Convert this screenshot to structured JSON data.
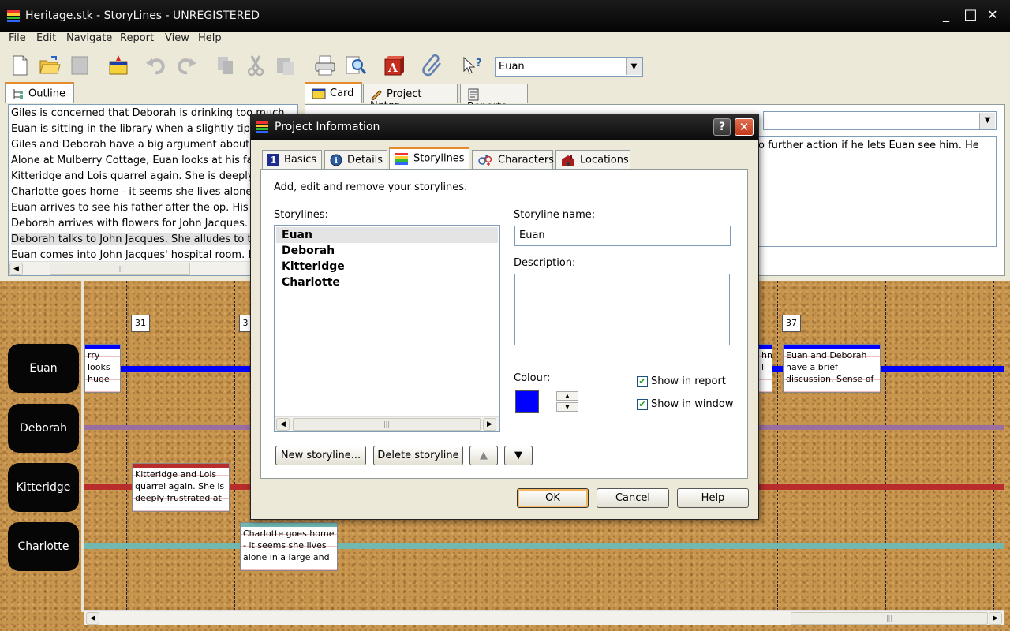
{
  "window": {
    "title": "Heritage.stk - StoryLines - UNREGISTERED",
    "controls": {
      "minimize": "_",
      "maximize": "□",
      "close": "✕"
    }
  },
  "menu": [
    "File",
    "Edit",
    "Navigate",
    "Report",
    "View",
    "Help"
  ],
  "toolbar": {
    "character_select": "Euan",
    "icons": [
      "new-document-icon",
      "open-folder-icon",
      "save-icon",
      "card-icon",
      "undo-icon",
      "redo-icon",
      "copy-icon",
      "cut-icon",
      "paste-icon",
      "print-icon",
      "print-preview-icon",
      "font-icon",
      "attach-icon",
      "help-pointer-icon"
    ]
  },
  "left_panel": {
    "tab": "Outline",
    "outline_rows": [
      "Giles is concerned that Deborah is drinking too much.",
      "Euan is sitting in the library when a slightly tipsy Deborah",
      "Giles and Deborah have a big argument about ferti",
      "Alone at Mulberry Cottage, Euan looks at his father",
      "Kitteridge and Lois quarrel again. She is deeply fru",
      "Charlotte goes home - it seems she lives alone in a",
      "Euan arrives to see his father after the op. His fath",
      "Deborah arrives with flowers for John Jacques. Eu",
      "Deborah talks to John Jacques. She alludes to the",
      "Euan comes into John Jacques' hospital room. Deb"
    ]
  },
  "right_panel": {
    "tabs": [
      "Card",
      "Project Notes",
      "Reports"
    ],
    "card_text": "o further action if he lets Euan see him. He"
  },
  "board": {
    "storylines": [
      {
        "name": "Euan",
        "color": "#0000ff"
      },
      {
        "name": "Deborah",
        "color": "#9a6fa0"
      },
      {
        "name": "Kitteridge",
        "color": "#b82c2c"
      },
      {
        "name": "Charlotte",
        "color": "#70b8b0"
      }
    ],
    "page_numbers": [
      "31",
      "3",
      "37"
    ],
    "cards": [
      {
        "text": "rry looks huge",
        "color": "#0000ff"
      },
      {
        "text": "Kitteridge and Lois quarrel again. She is deeply frustrated at",
        "color": "#b82c2c"
      },
      {
        "text": "Charlotte goes home - it seems she lives alone in a large and",
        "color": "#70b8b0"
      },
      {
        "text": "Euan and Deborah have a brief discussion. Sense of",
        "color": "#0000ff"
      },
      {
        "text": "hn ll",
        "color": "#0000ff"
      }
    ]
  },
  "dialog": {
    "title": "Project Information",
    "help": "?",
    "close": "✕",
    "tabs": [
      "Basics",
      "Details",
      "Storylines",
      "Characters",
      "Locations"
    ],
    "intro": "Add, edit and remove your storylines.",
    "storylines_label": "Storylines:",
    "storylines": [
      "Euan",
      "Deborah",
      "Kitteridge",
      "Charlotte"
    ],
    "name_label": "Storyline name:",
    "name_value": "Euan",
    "description_label": "Description:",
    "description_value": "",
    "colour_label": "Colour:",
    "colour_value": "#0000ff",
    "show_in_report": "Show in report",
    "show_in_report_checked": true,
    "show_in_window": "Show in window",
    "show_in_window_checked": true,
    "new_button": "New storyline...",
    "delete_button": "Delete storyline",
    "ok": "OK",
    "cancel": "Cancel",
    "help_button": "Help"
  }
}
